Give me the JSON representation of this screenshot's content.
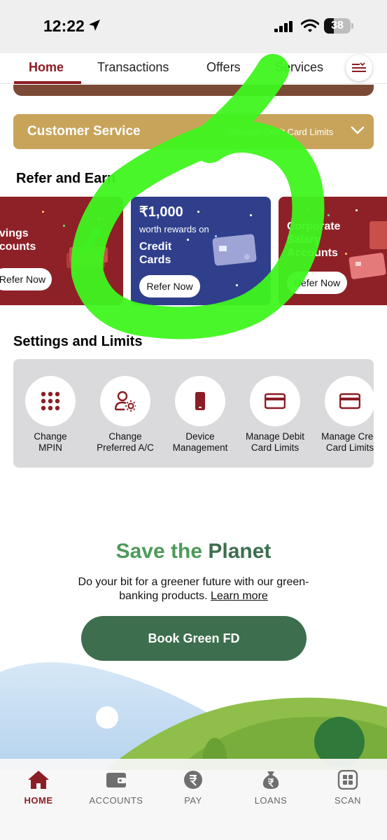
{
  "status_bar": {
    "time": "12:22",
    "battery": "38"
  },
  "top_nav": {
    "tabs": [
      {
        "label": "Home",
        "active": true
      },
      {
        "label": "Transactions"
      },
      {
        "label": "Offers"
      },
      {
        "label": "Services"
      }
    ]
  },
  "customer_service": {
    "title": "Customer Service",
    "subtitle": "Manage Debit Card Limits"
  },
  "refer_and_earn": {
    "title": "Refer and Earn",
    "cards": [
      {
        "lines": [
          "avings",
          "ccounts"
        ],
        "button": "Refer Now"
      },
      {
        "amount": "₹1,000",
        "caption": "worth rewards on",
        "lines": [
          "Credit",
          "Cards"
        ],
        "button": "Refer Now"
      },
      {
        "lines": [
          "Corporate",
          "Salary",
          "Accounts"
        ],
        "button": "Refer Now"
      }
    ]
  },
  "settings": {
    "title": "Settings and Limits",
    "items": [
      {
        "line1": "Change",
        "line2": "MPIN",
        "icon": "keypad-icon"
      },
      {
        "line1": "Change",
        "line2": "Preferred A/C",
        "icon": "user-settings-icon"
      },
      {
        "line1": "Device",
        "line2": "Management",
        "icon": "mobile-device-icon"
      },
      {
        "line1": "Manage Debit",
        "line2": "Card Limits",
        "icon": "card-icon"
      },
      {
        "line1": "Manage Cred",
        "line2": "Card Limits",
        "icon": "card-icon"
      }
    ]
  },
  "green_banner": {
    "title_part1": "Save the",
    "title_part2": "Planet",
    "description": "Do your bit for a greener future with our green-banking products.",
    "link": "Learn more",
    "button": "Book Green FD"
  },
  "bottom_nav": {
    "items": [
      {
        "label": "HOME",
        "icon": "home-icon",
        "active": true
      },
      {
        "label": "ACCOUNTS",
        "icon": "wallet-icon"
      },
      {
        "label": "PAY",
        "icon": "rupee-icon"
      },
      {
        "label": "LOANS",
        "icon": "money-bag-icon"
      },
      {
        "label": "SCAN",
        "icon": "scan-icon"
      }
    ]
  },
  "colors": {
    "brand": "#8b1d24",
    "customer_service": "#c8a45a",
    "card_red": "#8e2027",
    "card_blue": "#2f3f8c",
    "green_primary": "#3d6e4e",
    "marker_green": "#3ff51f"
  }
}
